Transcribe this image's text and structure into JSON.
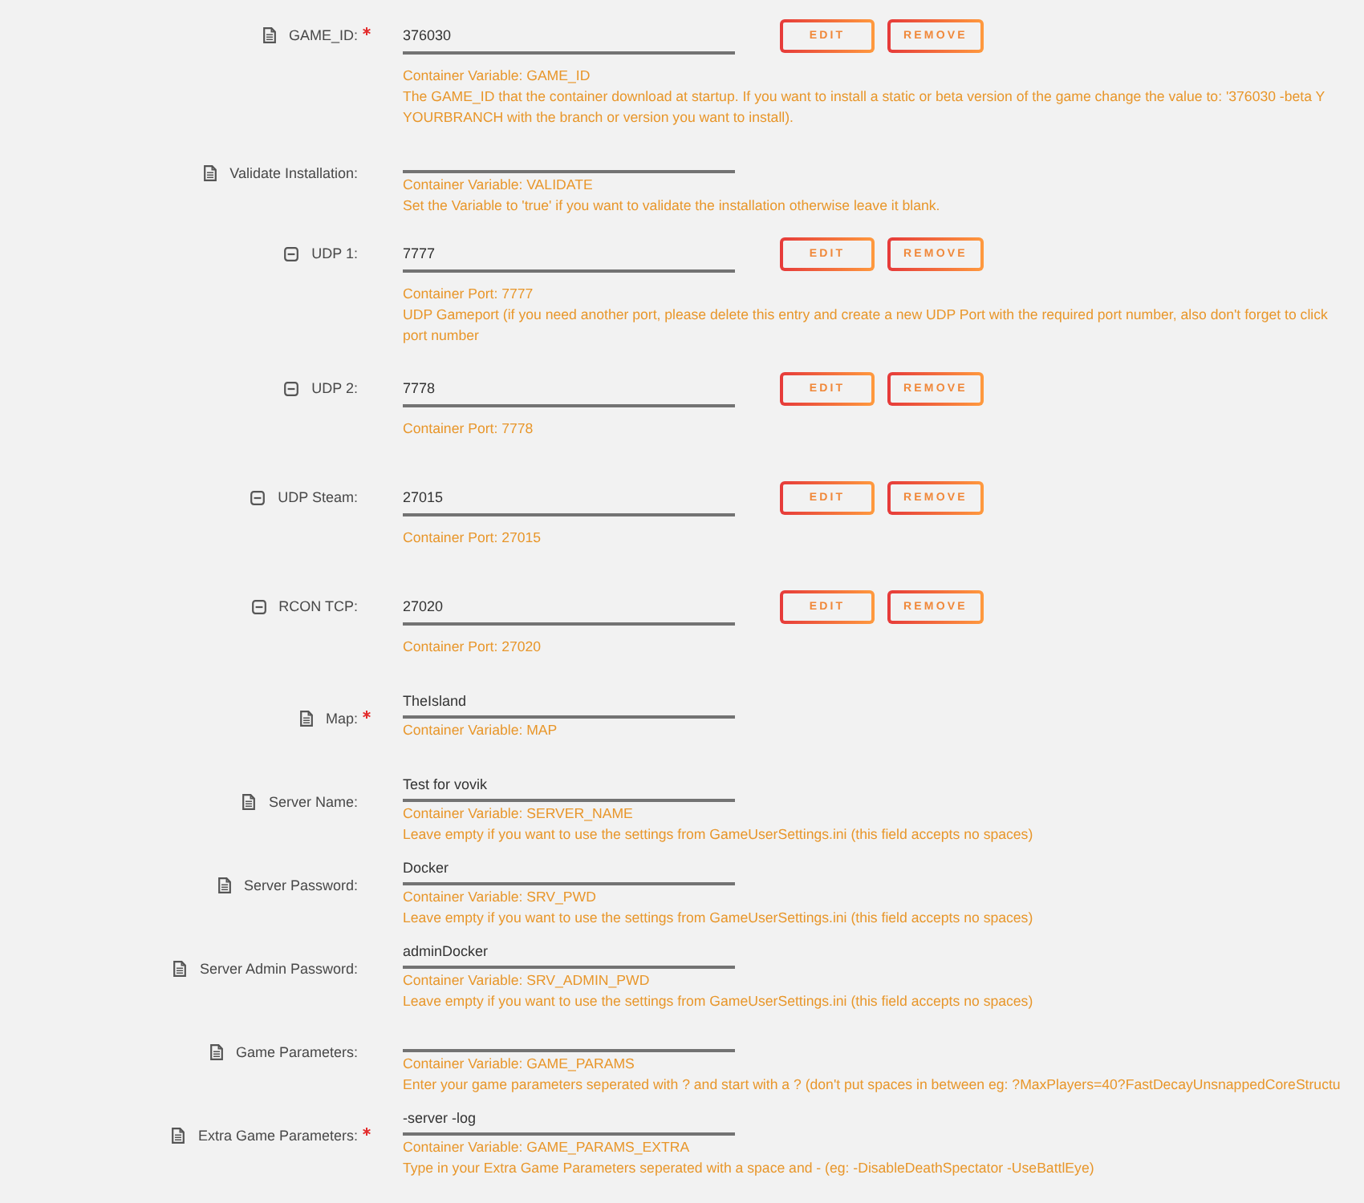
{
  "fields": [
    {
      "kind": "variable",
      "label": "GAME_ID:",
      "required": true,
      "value": "376030",
      "buttons": [
        "EDIT",
        "REMOVE"
      ],
      "note": "Container Variable: GAME_ID",
      "description": [
        "The GAME_ID that the container download at startup. If you want to install a static or beta version of the game change the value to: '376030 -beta Y",
        "YOURBRANCH with the branch or version you want to install)."
      ]
    },
    {
      "kind": "variable",
      "label": "Validate Installation:",
      "required": false,
      "note": "Container Variable: VALIDATE",
      "description": [
        "Set the Variable to 'true' if you want to validate the installation otherwise leave it blank."
      ]
    },
    {
      "kind": "port",
      "label": "UDP 1:",
      "required": false,
      "value": "7777",
      "buttons": [
        "EDIT",
        "REMOVE"
      ],
      "note": "Container Port: 7777",
      "description": [
        "UDP Gameport (if you need another port, please delete this entry and create a new UDP Port with the required port number, also don't forget to click",
        "port number"
      ]
    },
    {
      "kind": "port",
      "label": "UDP 2:",
      "required": false,
      "value": "7778",
      "buttons": [
        "EDIT",
        "REMOVE"
      ],
      "note": "Container Port: 7778"
    },
    {
      "kind": "port",
      "label": "UDP Steam:",
      "required": false,
      "value": "27015",
      "buttons": [
        "EDIT",
        "REMOVE"
      ],
      "note": "Container Port: 27015"
    },
    {
      "kind": "port",
      "label": "RCON TCP:",
      "required": false,
      "value": "27020",
      "buttons": [
        "EDIT",
        "REMOVE"
      ],
      "note": "Container Port: 27020"
    },
    {
      "kind": "variable",
      "label": "Map:",
      "required": true,
      "value": "TheIsland",
      "note": "Container Variable: MAP"
    },
    {
      "kind": "variable",
      "label": "Server Name:",
      "required": false,
      "value": "Test for vovik",
      "note": "Container Variable: SERVER_NAME",
      "description": [
        "Leave empty if you want to use the settings from GameUserSettings.ini (this field accepts no spaces)"
      ]
    },
    {
      "kind": "variable",
      "label": "Server Password:",
      "required": false,
      "value": "Docker",
      "note": "Container Variable: SRV_PWD",
      "description": [
        "Leave empty if you want to use the settings from GameUserSettings.ini (this field accepts no spaces)"
      ]
    },
    {
      "kind": "variable",
      "label": "Server Admin Password:",
      "required": false,
      "value": "adminDocker",
      "note": "Container Variable: SRV_ADMIN_PWD",
      "description": [
        "Leave empty if you want to use the settings from GameUserSettings.ini (this field accepts no spaces)"
      ]
    },
    {
      "kind": "variable",
      "label": "Game Parameters:",
      "required": false,
      "note": "Container Variable: GAME_PARAMS",
      "description": [
        "Enter your game parameters seperated with ? and start with a ? (don't put spaces in between eg: ?MaxPlayers=40?FastDecayUnsnappedCoreStructu"
      ]
    },
    {
      "kind": "variable",
      "label": "Extra Game Parameters:",
      "required": true,
      "value": "-server -log",
      "note": "Container Variable: GAME_PARAMS_EXTRA",
      "description": [
        "Type in your Extra Game Parameters seperated with a space and - (eg: -DisableDeathSpectator -UseBattlEye)"
      ]
    }
  ]
}
